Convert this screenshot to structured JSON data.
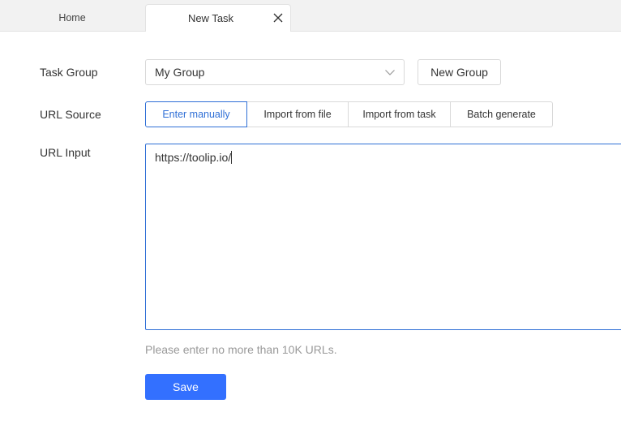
{
  "tabs": {
    "home_label": "Home",
    "new_task_label": "New Task",
    "close_icon": "close-icon"
  },
  "form": {
    "task_group": {
      "label": "Task Group",
      "selected_value": "My Group",
      "chevron_icon": "chevron-down-icon",
      "new_group_button": "New Group"
    },
    "url_source": {
      "label": "URL Source",
      "options": [
        "Enter manually",
        "Import from file",
        "Import from task",
        "Batch generate"
      ],
      "selected": "Enter manually"
    },
    "url_input": {
      "label": "URL Input",
      "value": "https://toolip.io/",
      "hint": "Please enter no more than 10K URLs."
    },
    "save_button": "Save"
  },
  "colors": {
    "accent": "#2f6fd6",
    "primary_button": "#3370ff",
    "hint_text": "#999999"
  }
}
